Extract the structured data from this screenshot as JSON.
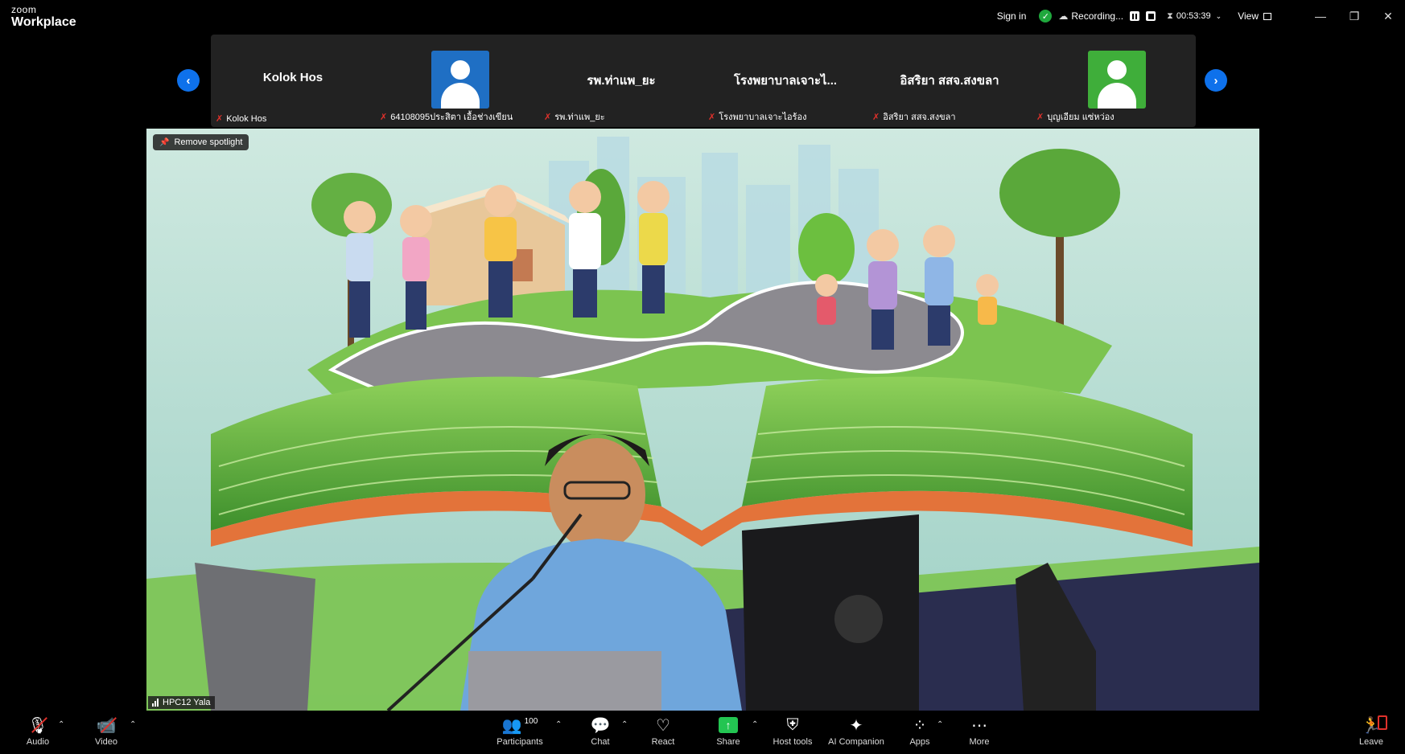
{
  "titlebar": {
    "brand_line1": "zoom",
    "brand_line2": "Workplace",
    "sign_in": "Sign in",
    "recording_label": "Recording...",
    "timer": "00:53:39",
    "view_label": "View"
  },
  "strip": {
    "tiles": [
      {
        "display_name": "Kolok Hos",
        "label": "Kolok Hos",
        "avatar": false
      },
      {
        "display_name": "",
        "label": "64108095ประสิตา เอื้อช่างเขียน",
        "avatar": true,
        "avatar_color": "#1f6fc4"
      },
      {
        "display_name": "รพ.ท่าแพ_ยะ",
        "label": "รพ.ท่าแพ_ยะ",
        "avatar": false
      },
      {
        "display_name": "โรงพยาบาลเจาะไ...",
        "label": "โรงพยาบาลเจาะไอร้อง",
        "avatar": false
      },
      {
        "display_name": "อิสริยา สสจ.สงขลา",
        "label": "อิสริยา สสจ.สงขลา",
        "avatar": false
      },
      {
        "display_name": "",
        "label": "บุญเอียม แซ่หว่อง",
        "avatar": true,
        "avatar_color": "#3fae3a"
      }
    ]
  },
  "video": {
    "spotlight_button": "Remove spotlight",
    "speaker_name": "HPC12 Yala"
  },
  "toolbar": {
    "audio": "Audio",
    "video": "Video",
    "participants": "Participants",
    "participants_count": "100",
    "chat": "Chat",
    "react": "React",
    "share": "Share",
    "host_tools": "Host tools",
    "ai_companion": "AI Companion",
    "apps": "Apps",
    "more": "More",
    "leave": "Leave"
  },
  "colors": {
    "accent_blue": "#0e71eb",
    "mute_red": "#e0312b",
    "share_green": "#23c552",
    "secure_green": "#1fa83d"
  }
}
